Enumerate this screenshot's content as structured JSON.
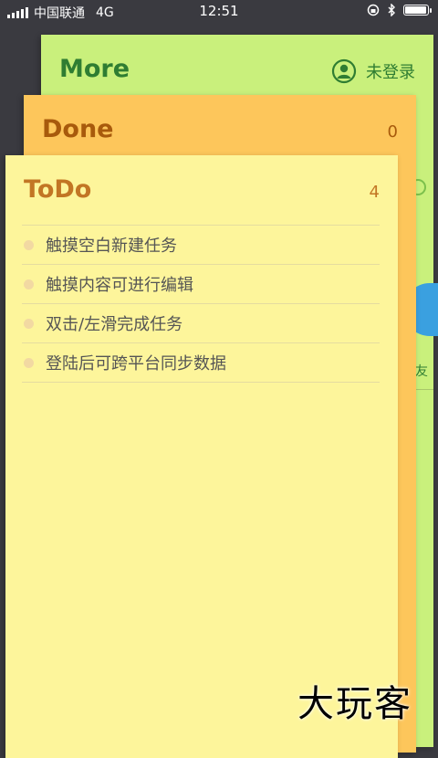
{
  "status_bar": {
    "carrier": "中国联通",
    "network": "4G",
    "time": "12:51",
    "battery_level": 0.95
  },
  "more_card": {
    "title": "More",
    "login_label": "未登录",
    "friend_label": "友"
  },
  "done_card": {
    "title": "Done",
    "count": "0"
  },
  "todo_card": {
    "title": "ToDo",
    "count": "4",
    "items": [
      {
        "text": "触摸空白新建任务"
      },
      {
        "text": "触摸内容可进行编辑"
      },
      {
        "text": "双击/左滑完成任务"
      },
      {
        "text": "登陆后可跨平台同步数据"
      }
    ]
  },
  "watermark": "大玩客",
  "colors": {
    "more_bg": "#c9f07c",
    "done_bg": "#fdc65b",
    "todo_bg": "#fdf59b",
    "more_text": "#2f7d32",
    "done_text": "#a85a0c",
    "todo_text": "#c27624"
  }
}
